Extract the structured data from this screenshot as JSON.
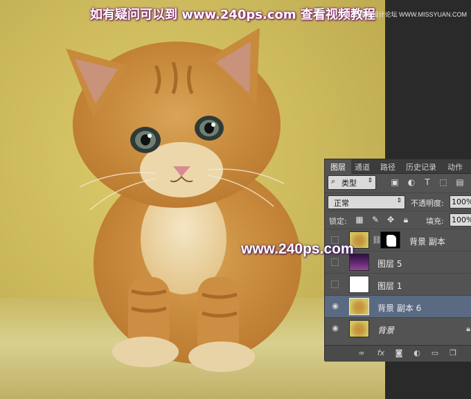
{
  "banner": {
    "text": "如有疑问可以到  www.240ps.com  查看视频教程",
    "site_mark": "思缘设计论坛  WWW.MISSYUAN.COM"
  },
  "watermark": "www.240ps.com",
  "panel": {
    "tabs": [
      {
        "label": "图层",
        "active": true
      },
      {
        "label": "通道",
        "active": false
      },
      {
        "label": "路径",
        "active": false
      },
      {
        "label": "历史记录",
        "active": false
      },
      {
        "label": "动作",
        "active": false
      }
    ],
    "filter": {
      "label": "类型",
      "icon": "search-icon"
    },
    "blend_mode": "正常",
    "opacity_label": "不透明度:",
    "opacity_value": "100%",
    "lock_label": "锁定:",
    "fill_label": "填充:",
    "fill_value": "100%",
    "layers": [
      {
        "name": "背景 副本",
        "thumb": "cat",
        "visible": false,
        "mask": true,
        "selected": false
      },
      {
        "name": "图层 5",
        "thumb": "purple",
        "visible": false,
        "mask": false,
        "selected": false
      },
      {
        "name": "图层 1",
        "thumb": "white",
        "visible": false,
        "mask": false,
        "selected": false
      },
      {
        "name": "背景 副本 6",
        "thumb": "cat",
        "visible": true,
        "mask": false,
        "selected": true
      },
      {
        "name": "背景",
        "thumb": "cat",
        "visible": true,
        "mask": false,
        "selected": false,
        "locked": true
      }
    ],
    "bottom_icons": [
      "link-icon",
      "fx-icon",
      "mask-icon",
      "adjustment-icon",
      "folder-icon",
      "new-layer-icon"
    ]
  },
  "colors": {
    "panel_bg": "#535353",
    "selected_row": "#596a82",
    "banner_shadow": "#7a1f6a"
  }
}
